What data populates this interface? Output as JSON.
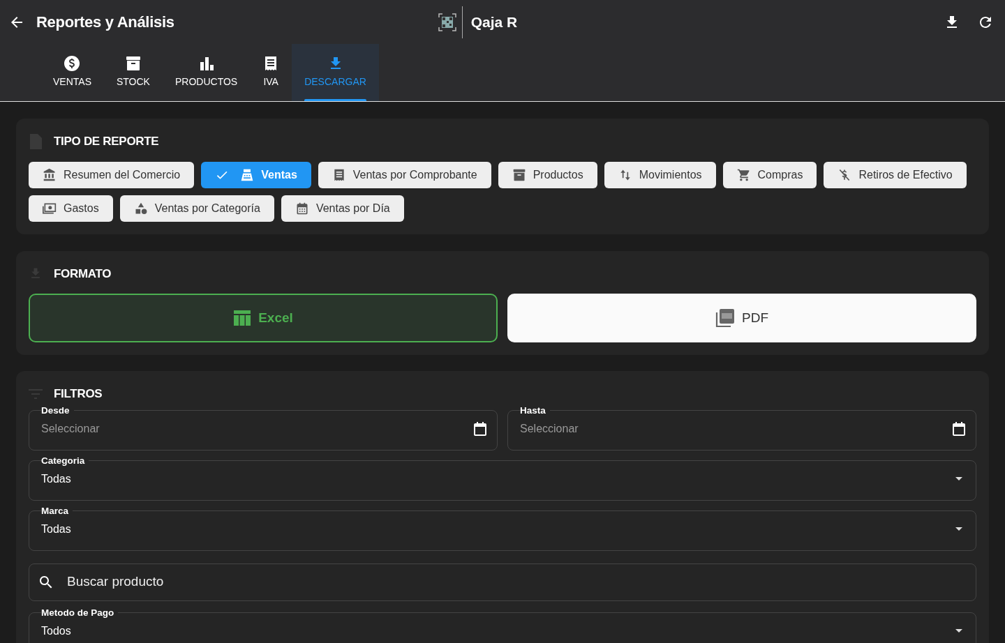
{
  "header": {
    "title": "Reportes y Análisis",
    "brand": "Qaja R"
  },
  "tabs": [
    {
      "label": "VENTAS",
      "selected": false
    },
    {
      "label": "STOCK",
      "selected": false
    },
    {
      "label": "PRODUCTOS",
      "selected": false
    },
    {
      "label": "IVA",
      "selected": false
    },
    {
      "label": "DESCARGAR",
      "selected": true
    }
  ],
  "report_type": {
    "title": "TIPO DE REPORTE",
    "options": [
      {
        "label": "Resumen del Comercio",
        "selected": false
      },
      {
        "label": "Ventas",
        "selected": true
      },
      {
        "label": "Ventas por Comprobante",
        "selected": false
      },
      {
        "label": "Productos",
        "selected": false
      },
      {
        "label": "Movimientos",
        "selected": false
      },
      {
        "label": "Compras",
        "selected": false
      },
      {
        "label": "Retiros de Efectivo",
        "selected": false
      },
      {
        "label": "Gastos",
        "selected": false
      },
      {
        "label": "Ventas por Categoría",
        "selected": false
      },
      {
        "label": "Ventas por Día",
        "selected": false
      }
    ]
  },
  "format": {
    "title": "FORMATO",
    "options": [
      {
        "label": "Excel",
        "selected": true
      },
      {
        "label": "PDF",
        "selected": false
      }
    ]
  },
  "filters": {
    "title": "FILTROS",
    "fields": [
      {
        "kind": "date",
        "label": "Desde",
        "placeholder": "Seleccionar"
      },
      {
        "kind": "date",
        "label": "Hasta",
        "placeholder": "Seleccionar"
      },
      {
        "kind": "select",
        "label": "Categoria",
        "value": "Todas"
      },
      {
        "kind": "select",
        "label": "Marca",
        "value": "Todas"
      },
      {
        "kind": "search",
        "placeholder": "Buscar producto"
      },
      {
        "kind": "select",
        "label": "Metodo de Pago",
        "value": "Todos"
      }
    ]
  }
}
